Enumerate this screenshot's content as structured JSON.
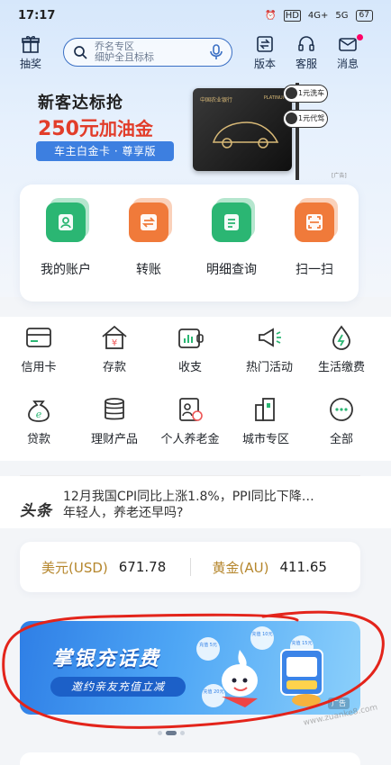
{
  "status": {
    "time": "17:17",
    "net": "HD",
    "signal1": "4G+",
    "signal2": "5G",
    "battery": "67"
  },
  "header": {
    "left_label": "抽奖",
    "search_lines": [
      "乔名专区",
      "细妒全且标标"
    ],
    "right_labels": [
      "版本",
      "客服",
      "消息"
    ]
  },
  "banner": {
    "line1": "新客达标抢",
    "amount": "250元",
    "amount_suffix": "加油金",
    "pill": "车主白金卡 · 尊享版",
    "card_bank": "中国农业银行",
    "card_tier": "PLATINUM",
    "sign1": "1元洗车",
    "sign2": "1元代驾",
    "ad": "[广告]"
  },
  "quick": [
    {
      "label": "我的账户",
      "color": "#2bb673",
      "icon": "person-icon"
    },
    {
      "label": "转账",
      "color": "#f07a3a",
      "icon": "transfer-icon"
    },
    {
      "label": "明细查询",
      "color": "#2bb673",
      "icon": "document-icon"
    },
    {
      "label": "扫一扫",
      "color": "#f07a3a",
      "icon": "scan-icon"
    }
  ],
  "grid": [
    {
      "label": "信用卡",
      "icon": "credit-card-icon"
    },
    {
      "label": "存款",
      "icon": "deposit-house-icon"
    },
    {
      "label": "收支",
      "icon": "wallet-chart-icon"
    },
    {
      "label": "热门活动",
      "icon": "megaphone-icon"
    },
    {
      "label": "生活缴费",
      "icon": "water-drop-icon"
    },
    {
      "label": "贷款",
      "icon": "money-bag-icon"
    },
    {
      "label": "理财产品",
      "icon": "coin-stack-icon"
    },
    {
      "label": "个人养老金",
      "icon": "pension-icon"
    },
    {
      "label": "城市专区",
      "icon": "city-building-icon"
    },
    {
      "label": "全部",
      "icon": "more-dots-icon"
    }
  ],
  "news": {
    "tag": "头条",
    "line1": "12月我国CPI同比上涨1.8%，PPI同比下降…",
    "line2": "年轻人，养老还早吗?"
  },
  "rates": [
    {
      "name": "美元(USD)",
      "value": "671.78"
    },
    {
      "name": "黄金(AU)",
      "value": "411.65"
    }
  ],
  "promo": {
    "title": "掌银充话费",
    "subtitle": "邀约亲友充值立减",
    "bubbles": [
      "充值 5元",
      "充值 10元",
      "充值 15元",
      "充值 20元"
    ],
    "ad": "广告"
  },
  "watermark": "www.zuanke8.com",
  "colors": {
    "accent": "#3d7fe0",
    "green": "#2bb673",
    "orange": "#f07a3a",
    "gold": "#b5862c",
    "promo": "#2f7fe6"
  }
}
